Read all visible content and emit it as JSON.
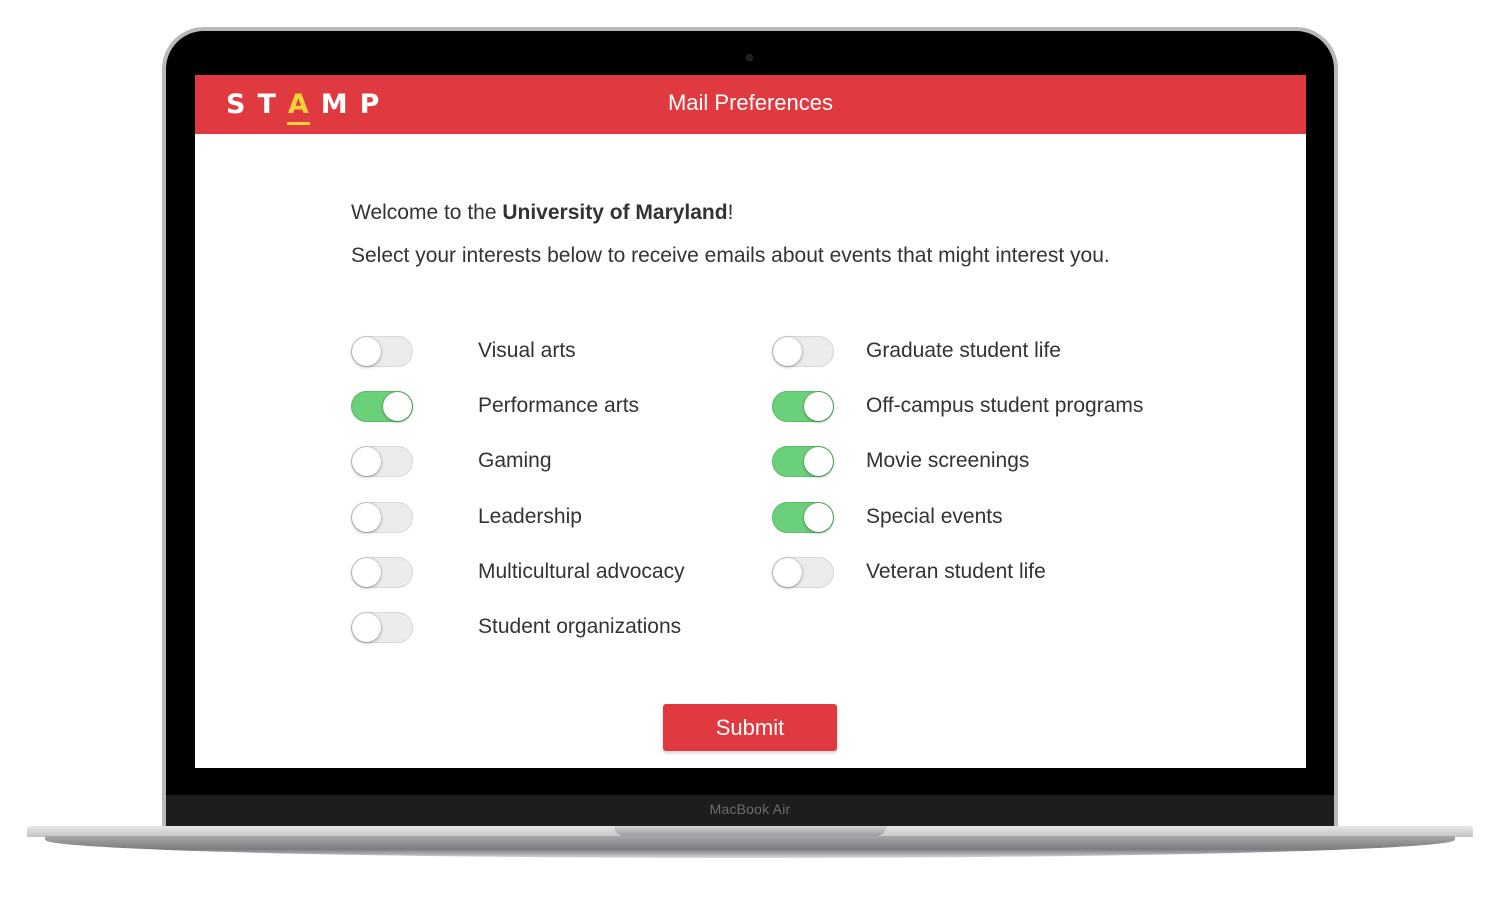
{
  "device": {
    "brand_label": "MacBook Air"
  },
  "header": {
    "logo_letters": [
      "S",
      "T",
      "A",
      "M",
      "P"
    ],
    "title": "Mail Preferences",
    "color": "#e0393f",
    "logo_accent_color": "#f6d23a"
  },
  "intro": {
    "welcome_prefix": "Welcome to the ",
    "university": "University of Maryland",
    "welcome_suffix": "!",
    "instructions": "Select your interests below to receive emails about events that might interest you."
  },
  "interests": {
    "left": [
      {
        "label": "Visual arts",
        "enabled": false
      },
      {
        "label": "Performance arts",
        "enabled": true
      },
      {
        "label": "Gaming",
        "enabled": false
      },
      {
        "label": "Leadership",
        "enabled": false
      },
      {
        "label": "Multicultural advocacy",
        "enabled": false
      },
      {
        "label": "Student organizations",
        "enabled": false
      }
    ],
    "right": [
      {
        "label": "Graduate student life",
        "enabled": false
      },
      {
        "label": "Off-campus student programs",
        "enabled": true
      },
      {
        "label": "Movie screenings",
        "enabled": true
      },
      {
        "label": "Special events",
        "enabled": true
      },
      {
        "label": "Veteran student life",
        "enabled": false
      }
    ]
  },
  "toggle_colors": {
    "on": "#6bd07a",
    "off": "#ececec"
  },
  "submit": {
    "label": "Submit"
  }
}
